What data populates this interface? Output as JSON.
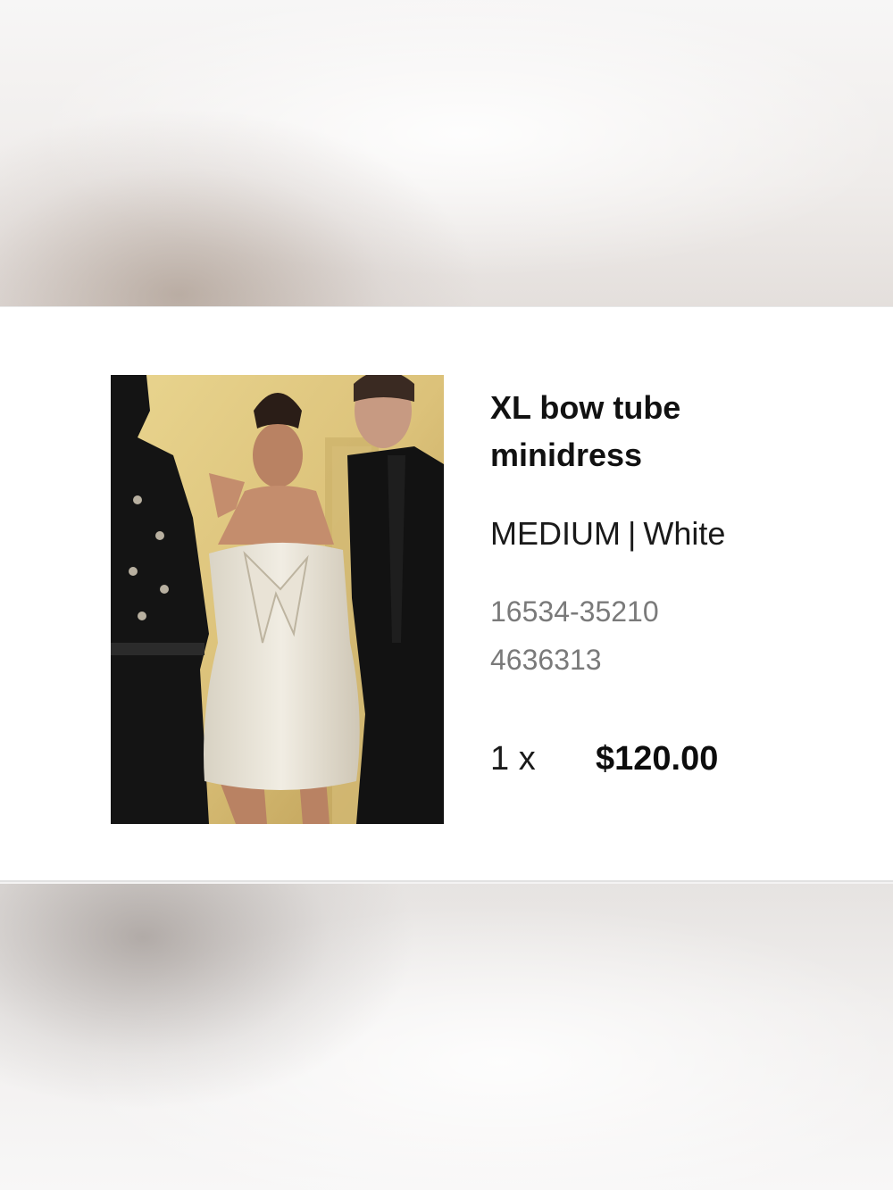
{
  "product": {
    "title": "XL bow tube minidress",
    "size": "MEDIUM",
    "separator": "|",
    "color": "White",
    "style_number": "16534-35210",
    "item_number": "4636313",
    "quantity_label": "1 x",
    "price": "$120.00"
  },
  "colors": {
    "card_background": "#ffffff",
    "text_primary": "#111111",
    "text_secondary": "#7a7a7a"
  }
}
